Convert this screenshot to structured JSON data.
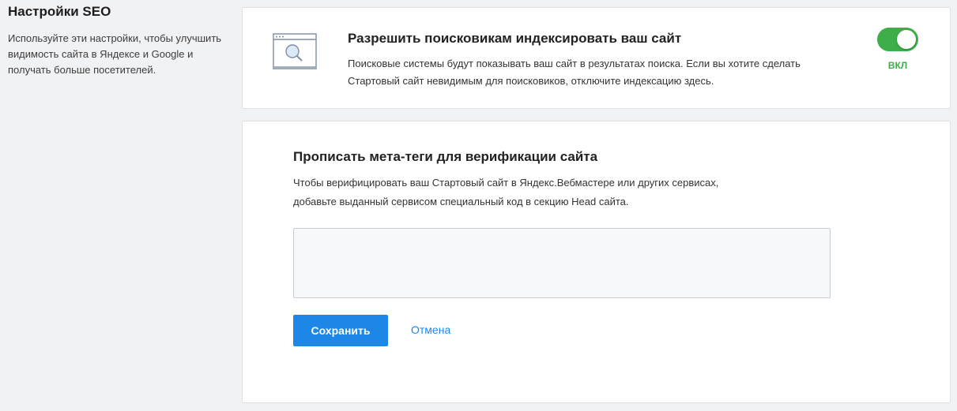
{
  "sidebar": {
    "title": "Настройки SEO",
    "description": "Используйте эти настройки, чтобы улучшить видимость сайта в Яндексе и Google и получать больше посетителей."
  },
  "indexing": {
    "icon": "browser-search-icon",
    "title": "Разрешить поисковикам индексировать ваш сайт",
    "description": "Поисковые системы будут показывать ваш сайт в результатах поиска. Если вы хотите сделать Стартовый сайт невидимым для поисковиков, отключите индексацию здесь.",
    "toggle_on": true,
    "toggle_state_label": "ВКЛ",
    "toggle_color": "#3dae4a"
  },
  "meta_tags": {
    "title": "Прописать мета-теги для верификации сайта",
    "description": "Чтобы верифицировать ваш Стартовый сайт в Яндекс.Вебмастере или других сервисах, добавьте выданный сервисом специальный код в секцию Head сайта.",
    "textarea_value": "",
    "save_label": "Сохранить",
    "cancel_label": "Отмена",
    "accent_color": "#1c87e6"
  }
}
